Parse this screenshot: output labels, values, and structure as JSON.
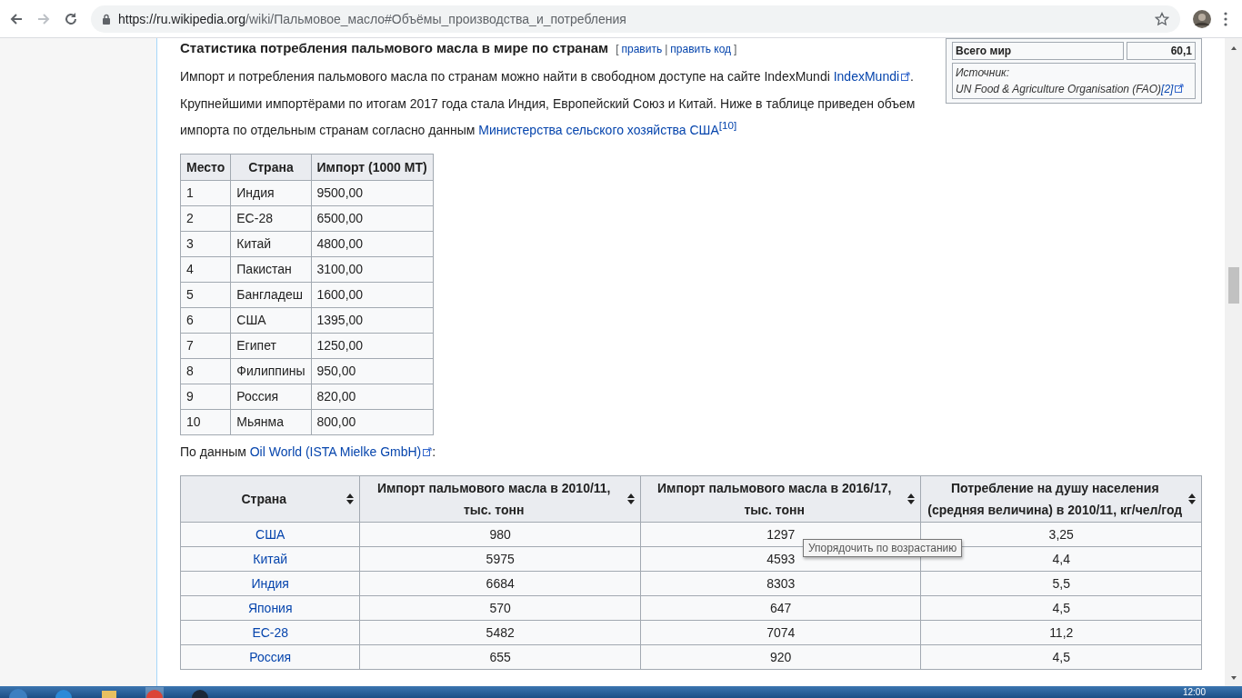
{
  "browser": {
    "url_host": "https://ru.wikipedia.org",
    "url_path": "/wiki/Пальмовое_масло#Объёмы_производства_и_потребления"
  },
  "section": {
    "heading": "Статистика потребления пальмового масла в мире по странам",
    "edit_open": "[",
    "edit_links": [
      "править",
      "править код"
    ],
    "edit_separator": "|",
    "edit_close": "]"
  },
  "infobox": {
    "rows": [
      {
        "label": "Всего мир",
        "value": "60,1"
      }
    ],
    "source_label": "Источник:",
    "source_text": "UN Food & Agriculture Organisation (FAO)",
    "source_ref": "[2]"
  },
  "paragraphs": [
    [
      {
        "kind": "text",
        "text": "Импорт и потребления пальмового масла по странам можно найти в свободном доступе на сайте IndexMundi "
      },
      {
        "kind": "extlink",
        "text": "IndexMundi"
      },
      {
        "kind": "text",
        "text": "."
      }
    ],
    [
      {
        "kind": "text",
        "text": "Крупнейшими импортёрами по итогам 2017 года стала Индия, Европейский Союз и Китай. Ниже в таблице приведен объем импорта по отдельным странам согласно данным "
      },
      {
        "kind": "link",
        "text": "Министерства сельского хозяйства США"
      },
      {
        "kind": "ref",
        "text": "[10]"
      }
    ]
  ],
  "import_table": {
    "columns": [
      "Место",
      "Страна",
      "Импорт (1000 МТ)"
    ],
    "rows": [
      [
        "1",
        "Индия",
        "9500,00"
      ],
      [
        "2",
        "ЕС-28",
        "6500,00"
      ],
      [
        "3",
        "Китай",
        "4800,00"
      ],
      [
        "4",
        "Пакистан",
        "3100,00"
      ],
      [
        "5",
        "Бангладеш",
        "1600,00"
      ],
      [
        "6",
        "США",
        "1395,00"
      ],
      [
        "7",
        "Египет",
        "1250,00"
      ],
      [
        "8",
        "Филиппины",
        "950,00"
      ],
      [
        "9",
        "Россия",
        "820,00"
      ],
      [
        "10",
        "Мьянма",
        "800,00"
      ]
    ]
  },
  "source_paragraph": [
    {
      "kind": "text",
      "text": "По данным "
    },
    {
      "kind": "extlink",
      "text": "Oil World (ISTA Mielke GmbH)"
    },
    {
      "kind": "text",
      "text": ":"
    }
  ],
  "sortable_table": {
    "columns": [
      "Страна",
      "Импорт пальмового масла в 2010/11, тыс. тонн",
      "Импорт пальмового масла в 2016/17, тыс. тонн",
      "Потребление на душу населения (средняя величина) в 2010/11, кг/чел/год"
    ],
    "rows": [
      [
        "США",
        "980",
        "1297",
        "3,25"
      ],
      [
        "Китай",
        "5975",
        "4593",
        "4,4"
      ],
      [
        "Индия",
        "6684",
        "8303",
        "5,5"
      ],
      [
        "Япония",
        "570",
        "647",
        "4,5"
      ],
      [
        "ЕС-28",
        "5482",
        "7074",
        "11,2"
      ],
      [
        "Россия",
        "655",
        "920",
        "4,5"
      ]
    ]
  },
  "tooltip": "Упорядочить по возрастанию",
  "taskbar": {
    "clock": "12:00"
  }
}
